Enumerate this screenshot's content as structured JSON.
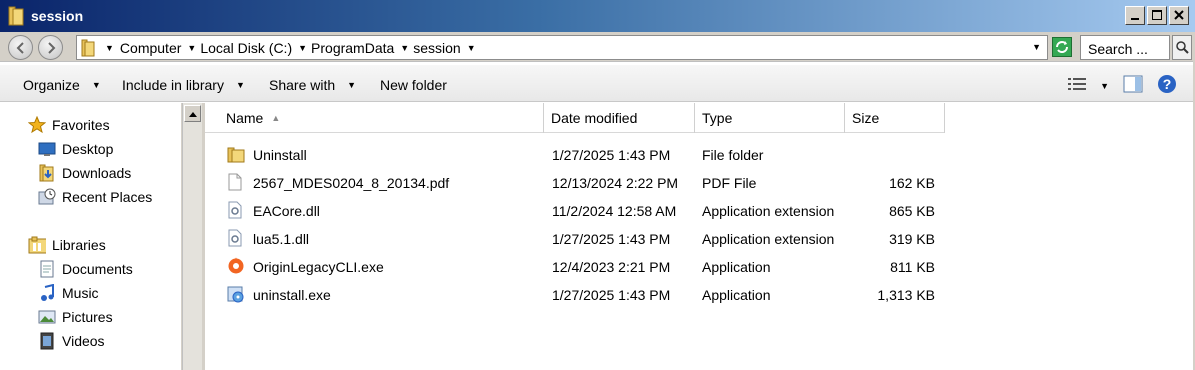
{
  "window": {
    "title": "session"
  },
  "address": {
    "breadcrumbs": [
      "Computer",
      "Local Disk (C:)",
      "ProgramData",
      "session"
    ],
    "search_placeholder": "Search ..."
  },
  "toolbar": {
    "organize": "Organize",
    "include_in_library": "Include in library",
    "share_with": "Share with",
    "new_folder": "New folder"
  },
  "sidebar": {
    "favorites_label": "Favorites",
    "favorites": [
      {
        "label": "Desktop",
        "icon": "desktop-icon"
      },
      {
        "label": "Downloads",
        "icon": "downloads-icon"
      },
      {
        "label": "Recent Places",
        "icon": "recent-places-icon"
      }
    ],
    "libraries_label": "Libraries",
    "libraries": [
      {
        "label": "Documents",
        "icon": "documents-icon"
      },
      {
        "label": "Music",
        "icon": "music-icon"
      },
      {
        "label": "Pictures",
        "icon": "pictures-icon"
      },
      {
        "label": "Videos",
        "icon": "videos-icon"
      }
    ]
  },
  "columns": {
    "name": "Name",
    "date_modified": "Date modified",
    "type": "Type",
    "size": "Size"
  },
  "files": [
    {
      "name": "Uninstall",
      "date": "1/27/2025 1:43 PM",
      "type": "File folder",
      "size": "",
      "icon": "folder-icon"
    },
    {
      "name": "2567_MDES0204_8_20134.pdf",
      "date": "12/13/2024 2:22 PM",
      "type": "PDF File",
      "size": "162 KB",
      "icon": "pdf-file-icon"
    },
    {
      "name": "EACore.dll",
      "date": "11/2/2024 12:58 AM",
      "type": "Application extension",
      "size": "865 KB",
      "icon": "dll-file-icon"
    },
    {
      "name": "lua5.1.dll",
      "date": "1/27/2025 1:43 PM",
      "type": "Application extension",
      "size": "319 KB",
      "icon": "dll-file-icon"
    },
    {
      "name": "OriginLegacyCLI.exe",
      "date": "12/4/2023 2:21 PM",
      "type": "Application",
      "size": "811 KB",
      "icon": "origin-app-icon"
    },
    {
      "name": "uninstall.exe",
      "date": "1/27/2025 1:43 PM",
      "type": "Application",
      "size": "1,313 KB",
      "icon": "installer-app-icon"
    }
  ]
}
